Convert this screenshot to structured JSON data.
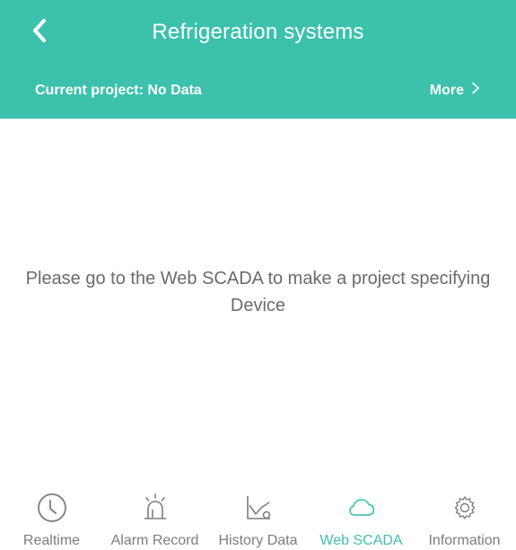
{
  "header": {
    "title": "Refrigeration systems",
    "back_icon": "chevron-left-icon",
    "project_label": "Current project: No Data",
    "more_label": "More",
    "more_icon": "chevron-right-icon",
    "background_color": "#3cc1ac"
  },
  "main": {
    "message": "Please go to the Web SCADA to make a project specifying\nDevice"
  },
  "tabbar": {
    "active_color": "#3cc1ac",
    "inactive_color": "#7d7d7d",
    "items": [
      {
        "label": "Realtime",
        "icon": "clock-icon",
        "active": false
      },
      {
        "label": "Alarm Record",
        "icon": "alarm-siren-icon",
        "active": false
      },
      {
        "label": "History Data",
        "icon": "line-chart-icon",
        "active": false
      },
      {
        "label": "Web SCADA",
        "icon": "cloud-icon",
        "active": true
      },
      {
        "label": "Information",
        "icon": "gear-icon",
        "active": false
      }
    ]
  }
}
